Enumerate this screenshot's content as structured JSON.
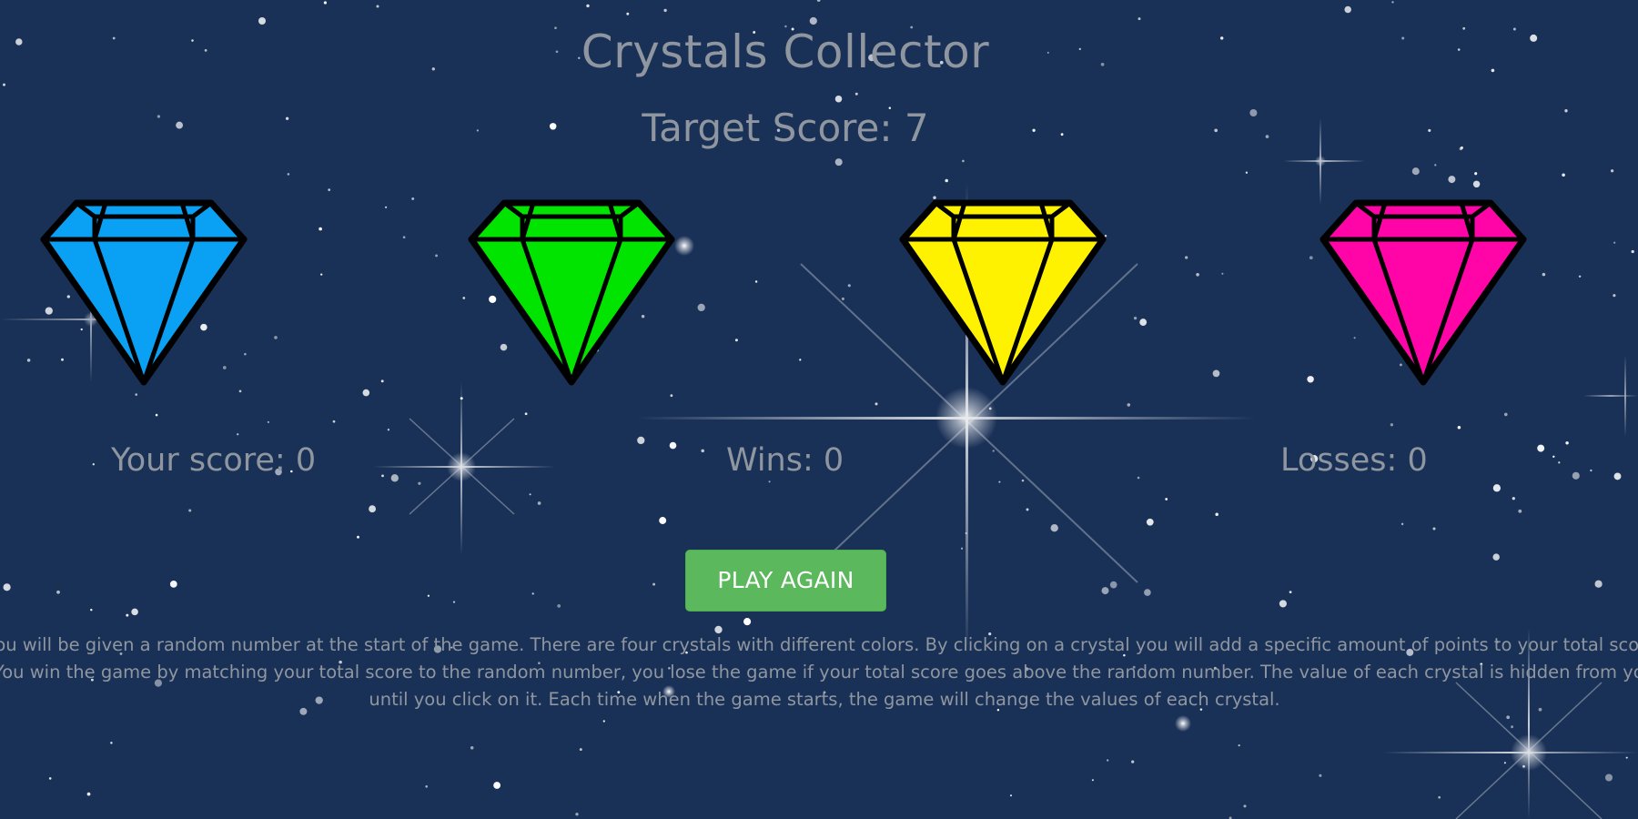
{
  "header": {
    "title": "Crystals Collector",
    "target_label": "Target Score:",
    "target_value": "7"
  },
  "crystals": [
    {
      "name": "blue",
      "color": "#0aa0f4"
    },
    {
      "name": "green",
      "color": "#00e400"
    },
    {
      "name": "yellow",
      "color": "#fff200"
    },
    {
      "name": "pink",
      "color": "#ff05a8"
    }
  ],
  "stats": {
    "score_label": "Your score:",
    "score_value": "0",
    "wins_label": "Wins:",
    "wins_value": "0",
    "losses_label": "Losses:",
    "losses_value": "0"
  },
  "actions": {
    "play_again_label": "PLAY AGAIN"
  },
  "instructions": "You will be given a random number at the start of the game. There are four crystals with different colors. By clicking on a crystal you will add a specific amount of points to your total score. You win the game by matching your total score to the random number, you lose the game if your total score goes above the random number. The value of each crystal is hidden from you until you click on it. Each time when the game starts, the game will change the values of each crystal.",
  "colors": {
    "background": "#1a3157",
    "text": "#8f969f",
    "button": "#5cb85c",
    "button_text": "#ffffff"
  }
}
